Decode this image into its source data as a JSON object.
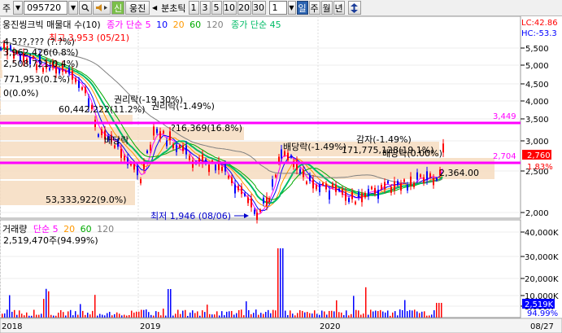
{
  "toolbar": {
    "code_prefix": "주",
    "stock_code": "095720",
    "search_icon": "search-icon",
    "link_icon": "speaker-link-icon",
    "new_label": "신",
    "stock_name": "웅진",
    "prev_arrow": "◀",
    "period_label": "분초틱",
    "intervals": [
      "1",
      "3",
      "5",
      "10",
      "20",
      "30"
    ],
    "count_value": "1",
    "period_tabs": [
      "일",
      "주",
      "월",
      "년"
    ],
    "scroll_icon": "up-down-icon"
  },
  "price_panel": {
    "legend_title": "웅진씽크빅 매물대 수(10)",
    "legend_ma": "종가 단순",
    "ma_periods": [
      "5",
      "10",
      "20",
      "60",
      "120"
    ],
    "legend_ma2": "종가 단순 45",
    "lc_label": "LC:42.86",
    "hc_label": "HC:-53.3",
    "volume_profile_labels": [
      "4,5??,??? (?.?%)",
      "3,962,426(0.8%)",
      "2,508,721(0.4%)",
      "771,953(0.1%)",
      "0(0.0%)",
      "60,442,222(11.2%)",
      "?16,369(16.8%)",
      "171,775,128(19.1%)",
      "53,333,922(9.0%)"
    ],
    "high_annotation": "최고 3,953 (05/21)",
    "low_annotation": "최저 1,946 (08/06)",
    "events": [
      "권리락(-19.30%)",
      "권리락(-1.49%)",
      "배당락",
      "배당락(-1.49%)",
      "감자(-1.49%)",
      "배당락(0.00%)"
    ],
    "level_upper": "3,449",
    "level_lower": "2,704",
    "current_price": "2,760",
    "change_pct": "1.83%",
    "last_value": "2,364.00",
    "y_ticks": [
      "5,500",
      "5,000",
      "4,500",
      "4,000",
      "3,500",
      "3,000",
      "2,500",
      "2,000"
    ]
  },
  "volume_panel": {
    "legend_title": "거래량",
    "legend_ma": "단순",
    "ma_periods": [
      "5",
      "20",
      "60",
      "120"
    ],
    "value_label": "2,519,470주(94.99%)",
    "current_badge": "2,519K",
    "current_pct": "94.99%",
    "y_ticks": [
      "40,000K",
      "30,000K",
      "20,000K",
      "10,000K",
      "5,000K"
    ]
  },
  "x_axis": {
    "labels": [
      "2018",
      "2019",
      "2020",
      "08/27"
    ]
  },
  "colors": {
    "ma5": "#ff00ff",
    "ma10": "#0000ff",
    "ma20": "#ff9900",
    "ma60": "#00aa00",
    "ma120": "#808080",
    "ma45": "#00bb66",
    "candle_up": "#ff0000",
    "candle_down": "#0000ff",
    "level_line": "#ff00ff",
    "profile_bar": "#f6dcc0"
  }
}
